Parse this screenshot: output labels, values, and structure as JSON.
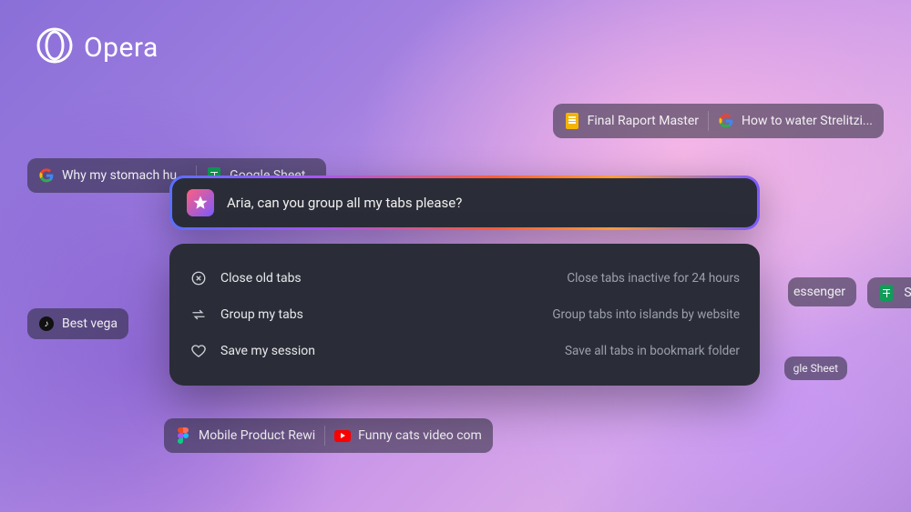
{
  "brand": {
    "name": "Opera"
  },
  "aria": {
    "prompt": "Aria, can you group all my tabs please?",
    "suggestions": [
      {
        "title": "Close old tabs",
        "desc": "Close tabs inactive for 24 hours"
      },
      {
        "title": "Group my tabs",
        "desc": "Group tabs into islands by website"
      },
      {
        "title": "Save my session",
        "desc": "Save all tabs in bookmark folder"
      }
    ]
  },
  "tabs": {
    "group_top_right": [
      {
        "icon": "docs",
        "label": "Final Raport Master"
      },
      {
        "icon": "google",
        "label": "How to water Strelitzi..."
      }
    ],
    "group_left": [
      {
        "icon": "google",
        "label": "Why my stomach hu..."
      },
      {
        "icon": "sheets",
        "label": "Google Sheet..."
      }
    ],
    "tiktok": {
      "icon": "tiktok",
      "label": "Best vega"
    },
    "messenger_frag": "essenger",
    "september_frag": "Septe",
    "sheet_frag": "gle Sheet",
    "group_bottom": [
      {
        "icon": "figma",
        "label": "Mobile Product Rewi"
      },
      {
        "icon": "youtube",
        "label": "Funny cats video com"
      }
    ]
  }
}
